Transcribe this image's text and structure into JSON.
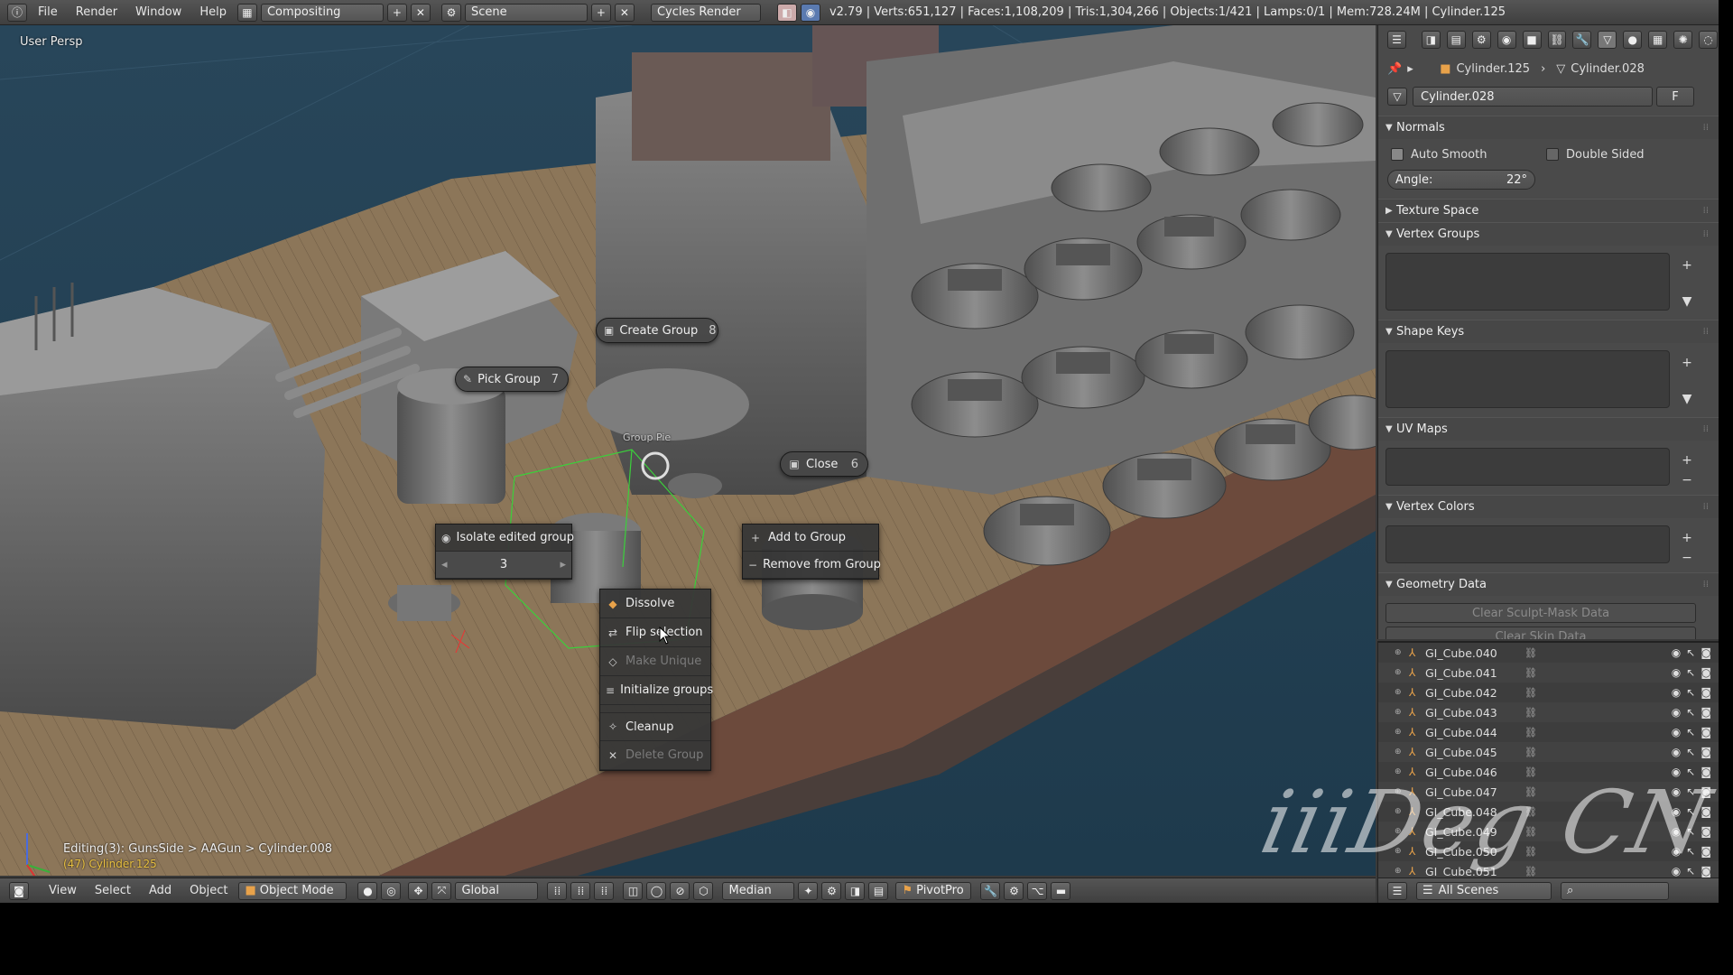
{
  "topbar": {
    "menus": [
      "File",
      "Render",
      "Window",
      "Help"
    ],
    "layout_name": "Compositing",
    "scene_name": "Scene",
    "render_engine": "Cycles Render",
    "stats": "v2.79 | Verts:651,127 | Faces:1,108,209 | Tris:1,304,266 | Objects:1/421 | Lamps:0/1 | Mem:728.24M | Cylinder.125"
  },
  "viewport": {
    "view_label": "User Persp",
    "editing_path": "Editing(3): GunsSide > AAGun > Cylinder.008",
    "object_info": "(47) Cylinder.125",
    "pie_items": {
      "create_group": {
        "label": "Create Group",
        "key": "8"
      },
      "pick_group": {
        "label": "Pick Group",
        "key": "7"
      },
      "close": {
        "label": "Close",
        "key": "6"
      },
      "group_pie_label": "Group Pie"
    },
    "isolate": {
      "label": "Isolate edited group",
      "value": "3"
    },
    "group_menu": {
      "add": "Add to Group",
      "remove": "Remove from Group"
    },
    "context_menu": [
      {
        "label": "Dissolve",
        "enabled": true
      },
      {
        "label": "Flip selection",
        "enabled": true
      },
      {
        "label": "Make Unique",
        "enabled": false
      },
      {
        "label": "Initialize groups",
        "enabled": true
      },
      {
        "label": "Cleanup",
        "enabled": true
      },
      {
        "label": "Delete Group",
        "enabled": false
      }
    ]
  },
  "viewport_header": {
    "menus": [
      "View",
      "Select",
      "Add",
      "Object"
    ],
    "mode": "Object Mode",
    "orientation": "Global",
    "pivot": "Median",
    "addon_button": "PivotPro"
  },
  "properties": {
    "breadcrumb_object": "Cylinder.125",
    "breadcrumb_mesh": "Cylinder.028",
    "mesh_name": "Cylinder.028",
    "fake_user": "F",
    "normals": {
      "title": "Normals",
      "auto_smooth": "Auto Smooth",
      "double_sided": "Double Sided",
      "angle_label": "Angle:",
      "angle_value": "22°"
    },
    "panels": {
      "texture_space": "Texture Space",
      "vertex_groups": "Vertex Groups",
      "shape_keys": "Shape Keys",
      "uv_maps": "UV Maps",
      "vertex_colors": "Vertex Colors",
      "geometry_data": "Geometry Data"
    },
    "geometry_buttons": {
      "clear_sculpt": "Clear Sculpt-Mask Data",
      "clear_skin": "Clear Skin Data"
    }
  },
  "outliner": {
    "items": [
      "GI_Cube.040",
      "GI_Cube.041",
      "GI_Cube.042",
      "GI_Cube.043",
      "GI_Cube.044",
      "GI_Cube.045",
      "GI_Cube.046",
      "GI_Cube.047",
      "GI_Cube.048",
      "GI_Cube.049",
      "GI_Cube.050",
      "GI_Cube.051"
    ],
    "scene_filter": "All Scenes"
  },
  "watermark": "iiiDeg CN",
  "colors": {
    "sea": "#2c4a5c",
    "deck": "#8b7458",
    "hull": "#6a6a6a",
    "panel_bg": "#4a4a4a",
    "header_bg": "#555555"
  }
}
